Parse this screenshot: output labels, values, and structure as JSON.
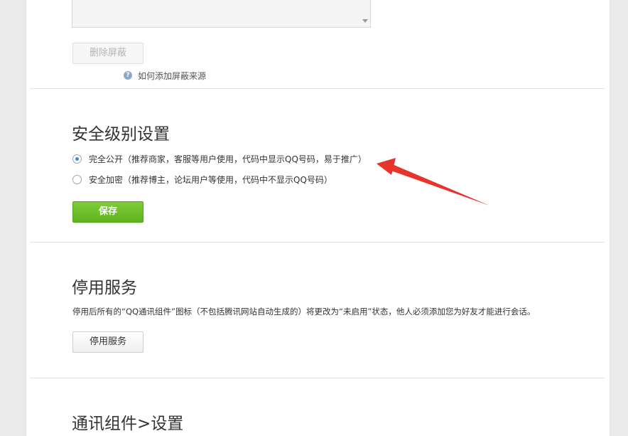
{
  "filter_section": {
    "remove_button_label": "删除屏蔽",
    "help_link": "如何添加屏蔽来源"
  },
  "security": {
    "title": "安全级别设置",
    "options": [
      {
        "label": "完全公开（推荐商家，客服等用户使用，代码中显示QQ号码，易于推广）",
        "selected": true
      },
      {
        "label": "安全加密（推荐博主，论坛用户等使用，代码中不显示QQ号码）",
        "selected": false
      }
    ],
    "save_button_label": "保存"
  },
  "disable": {
    "title": "停用服务",
    "description": "停用后所有的“QQ通讯组件”图标（不包括腾讯网站自动生成的）将更改为“未启用”状态，他人必须添加您为好友才能进行会话。",
    "button_label": "停用服务"
  },
  "widget_settings": {
    "title": "通讯组件>设置"
  },
  "colors": {
    "annotation_arrow": "#e8332a",
    "primary_button": "#6abf2a",
    "radio_selected": "#3b88d8"
  }
}
